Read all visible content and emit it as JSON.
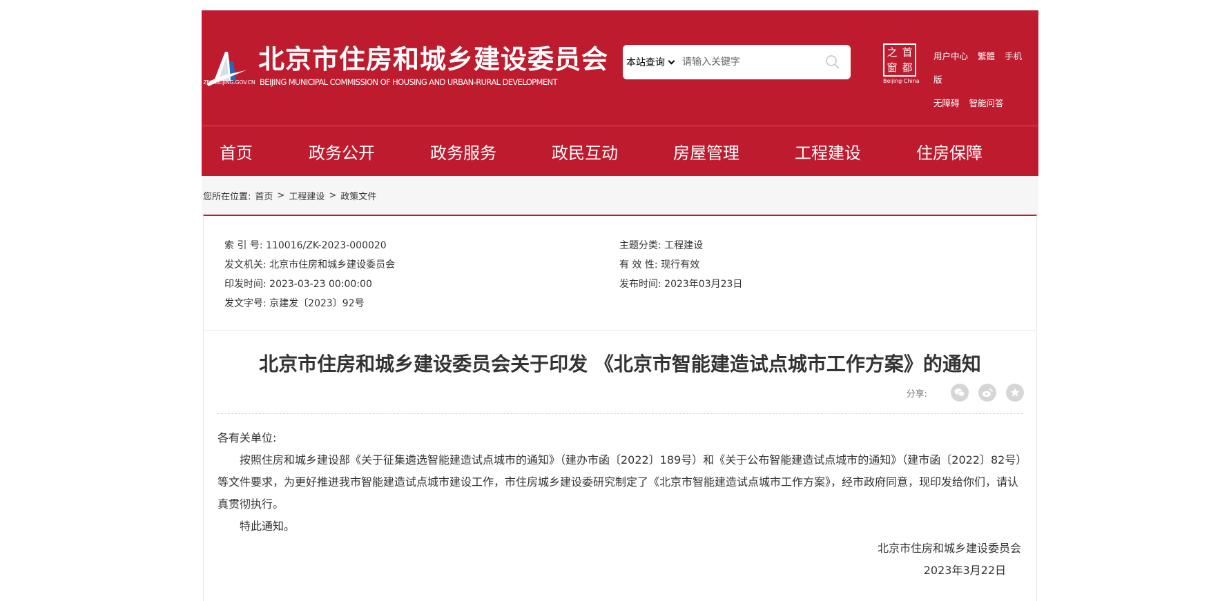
{
  "header": {
    "logo_url_text": "ZJW.BEIJING.GOV.CN",
    "title": "北京市住房和城乡建设委员会",
    "subtitle": "BEIJING MUNICIPAL COMMISSION OF HOUSING AND URBAN-RURAL DEVELOPMENT",
    "search_scope": "本站查询",
    "search_placeholder": "请输入关键字",
    "capital_chars": [
      "之",
      "首",
      "窗",
      "都"
    ],
    "capital_en": "Beijing·China",
    "links_row1": [
      "用户中心",
      "繁體",
      "手机版"
    ],
    "links_row2": [
      "无障碍",
      "智能问答"
    ]
  },
  "nav": [
    "首页",
    "政务公开",
    "政务服务",
    "政民互动",
    "房屋管理",
    "工程建设",
    "住房保障"
  ],
  "breadcrumb": {
    "prefix": "您所在位置:",
    "items": [
      "首页",
      "工程建设",
      "政策文件"
    ],
    "sep": ">"
  },
  "meta": {
    "index_label": "索 引 号:",
    "index_value": "110016/ZK-2023-000020",
    "topic_label": "主题分类:",
    "topic_value": "工程建设",
    "issuer_label": "发文机关:",
    "issuer_value": "北京市住房和城乡建设委员会",
    "validity_label": "有 效 性:",
    "validity_value": "现行有效",
    "printed_label": "印发时间:",
    "printed_value": "2023-03-23 00:00:00",
    "published_label": "发布时间:",
    "published_value": "2023年03月23日",
    "docno_label": "发文字号:",
    "docno_value": "京建发〔2023〕92号"
  },
  "article": {
    "title": "北京市住房和城乡建设委员会关于印发 《北京市智能建造试点城市工作方案》的通知",
    "share_label": "分享:",
    "share_icons": [
      "wechat-icon",
      "weibo-icon",
      "favorite-icon"
    ],
    "salutation": "各有关单位:",
    "paragraph1": "按照住房和城乡建设部《关于征集遴选智能建造试点城市的通知》（建办市函〔2022〕189号）和《关于公布智能建造试点城市的通知》（建市函〔2022〕82号）等文件要求，为更好推进我市智能建造试点城市建设工作，市住房城乡建设委研究制定了《北京市智能建造试点城市工作方案》，经市政府同意，现印发给你们，请认真贯彻执行。",
    "paragraph2": "特此通知。",
    "signature": "北京市住房和城乡建设委员会",
    "date": "2023年3月22日"
  },
  "colors": {
    "brand_red": "#be1b2e",
    "crumb_bg": "#f6f6f6"
  }
}
